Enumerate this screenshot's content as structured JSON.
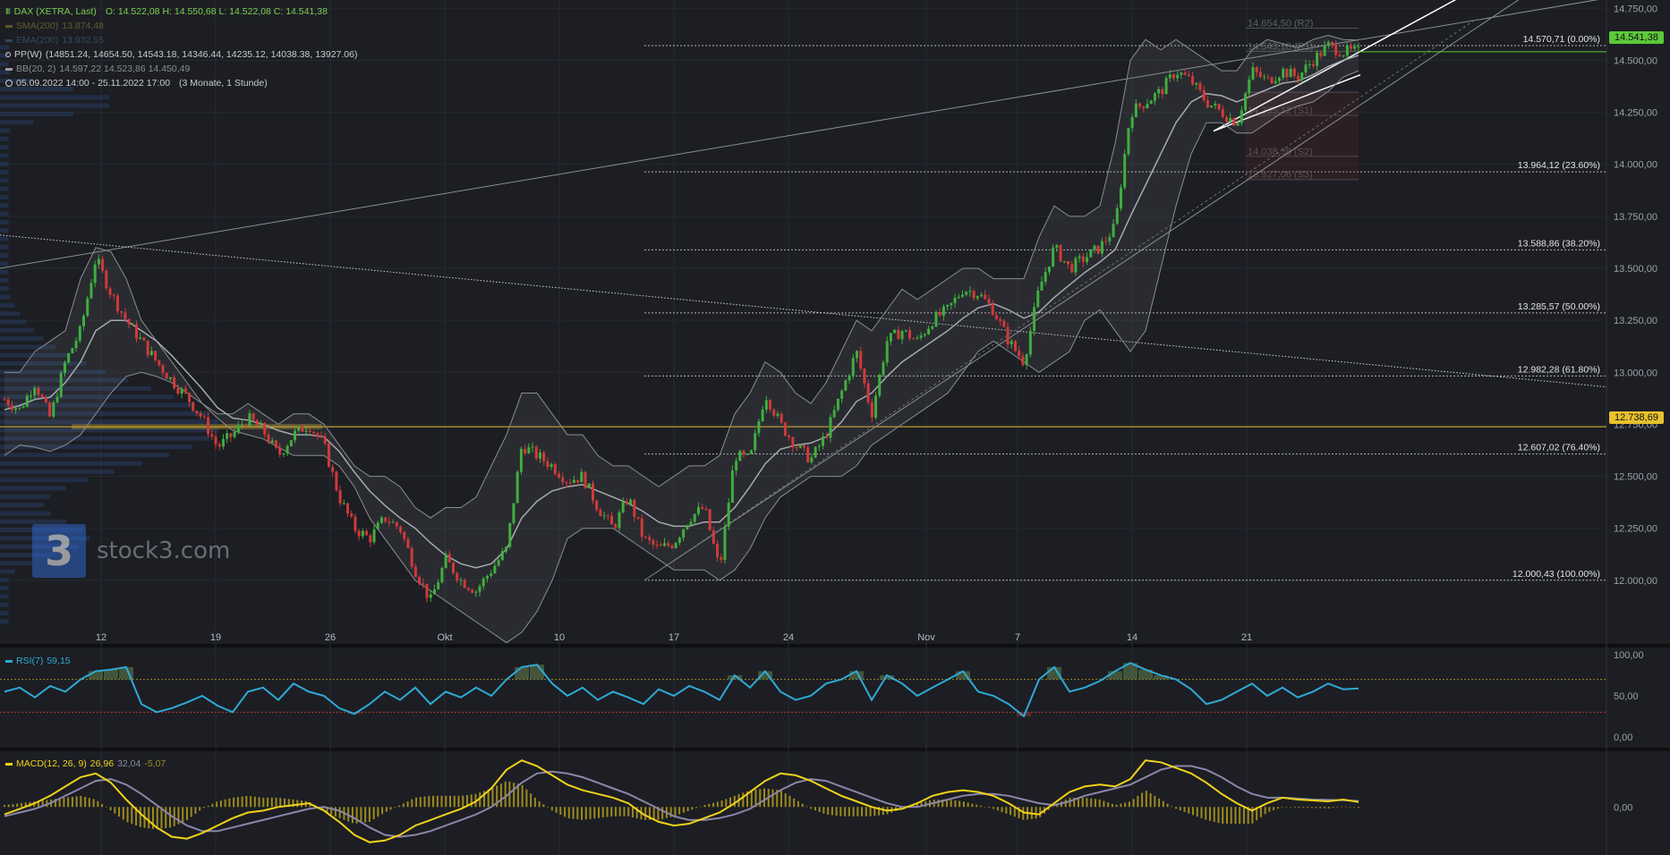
{
  "header": {
    "title": "DAX (XETRA, Last)",
    "ohlc": "O: 14.522,08  H: 14.550,68  L: 14.522,08  C: 14.541,38",
    "sma": "SMA(200)",
    "sma_value": "13.874,48",
    "ema": "EMA(200)",
    "ema_value": "13.932,55",
    "pp": "PP(W)",
    "pp_values": "(14851.24, 14654.50, 14543.18, 14346.44, 14235.12, 14038.38, 13927.06)",
    "bb": "BB(20, 2)",
    "bb_values": "14.597,22  14.523,86  14.450,49",
    "period": "05.09.2022 14:00 - 25.11.2022 17:00",
    "period_note": "(3 Monate, 1 Stunde)"
  },
  "rsi_panel": {
    "label": "RSI(7)",
    "value": "59,15"
  },
  "macd_panel": {
    "label": "MACD(12, 26, 9)",
    "v1": "26,96",
    "v2": "32,04",
    "v3": "-5,07"
  },
  "watermark": {
    "logo_glyph": "3",
    "brand": "stock3.com"
  },
  "colors": {
    "background": "#1c1e23",
    "up": "#3fae3f",
    "down": "#d03a3a",
    "rsi": "#2eaad6",
    "macd": "#f2d21b",
    "signal": "#8b86a8",
    "hist": "#9c8a1e",
    "highlight": "#e8c12d",
    "last_price": "#5dc93a"
  },
  "chart_data": [
    {
      "type": "candlestick",
      "title": "DAX (XETRA, Last)",
      "x_ticks": [
        "12",
        "19",
        "26",
        "Okt",
        "10",
        "17",
        "24",
        "Nov",
        "7",
        "14",
        "21"
      ],
      "y_ticks": [
        "12.000,00",
        "12.250,00",
        "12.500,00",
        "12.750,00",
        "13.000,00",
        "13.250,00",
        "13.500,00",
        "13.750,00",
        "14.000,00",
        "14.250,00",
        "14.500,00",
        "14.750,00"
      ],
      "y_tick_values": [
        12000,
        12250,
        12500,
        12750,
        13000,
        13250,
        13500,
        13750,
        14000,
        14250,
        14500,
        14750
      ],
      "ylim": [
        11750,
        14790
      ],
      "close_path": [
        12870,
        12820,
        12950,
        12780,
        13050,
        13200,
        13550,
        13380,
        13250,
        13150,
        13050,
        12960,
        12880,
        12780,
        12640,
        12700,
        12780,
        12720,
        12600,
        12700,
        12750,
        12650,
        12400,
        12250,
        12200,
        12300,
        12250,
        12050,
        11900,
        12100,
        12000,
        11950,
        12050,
        12150,
        12650,
        12600,
        12550,
        12480,
        12500,
        12350,
        12250,
        12400,
        12200,
        12150,
        12180,
        12300,
        12350,
        12050,
        12600,
        12580,
        12900,
        12750,
        12650,
        12580,
        12700,
        12900,
        13100,
        12800,
        13150,
        13200,
        13150,
        13250,
        13300,
        13400,
        13380,
        13300,
        13150,
        13050,
        13400,
        13600,
        13500,
        13550,
        13600,
        13700,
        14250,
        14300,
        14350,
        14450,
        14400,
        14300,
        14250,
        14200,
        14450,
        14400,
        14450,
        14420,
        14500,
        14570,
        14540,
        14541
      ],
      "bb_upper": [
        13000,
        13000,
        13100,
        13150,
        13200,
        13450,
        13600,
        13580,
        13450,
        13250,
        13150,
        13050,
        12950,
        12850,
        12800,
        12800,
        12850,
        12800,
        12750,
        12800,
        12800,
        12750,
        12650,
        12550,
        12500,
        12500,
        12450,
        12350,
        12300,
        12350,
        12350,
        12400,
        12550,
        12700,
        12900,
        12900,
        12800,
        12700,
        12700,
        12600,
        12550,
        12550,
        12500,
        12450,
        12500,
        12550,
        12550,
        12600,
        12800,
        12900,
        13050,
        13000,
        12900,
        12850,
        12950,
        13100,
        13250,
        13200,
        13300,
        13400,
        13350,
        13400,
        13450,
        13500,
        13500,
        13450,
        13450,
        13450,
        13650,
        13800,
        13750,
        13750,
        13800,
        14100,
        14500,
        14600,
        14550,
        14600,
        14550,
        14500,
        14450,
        14450,
        14550,
        14600,
        14580,
        14560,
        14600,
        14620,
        14600,
        14597
      ],
      "bb_middle": [
        12820,
        12840,
        12870,
        12880,
        12950,
        13050,
        13200,
        13250,
        13250,
        13200,
        13150,
        13080,
        13000,
        12920,
        12830,
        12780,
        12770,
        12750,
        12720,
        12700,
        12700,
        12690,
        12620,
        12520,
        12430,
        12360,
        12300,
        12250,
        12180,
        12120,
        12080,
        12060,
        12080,
        12150,
        12300,
        12380,
        12430,
        12450,
        12460,
        12430,
        12400,
        12370,
        12330,
        12280,
        12260,
        12260,
        12280,
        12280,
        12350,
        12450,
        12560,
        12630,
        12650,
        12660,
        12690,
        12760,
        12860,
        12900,
        12980,
        13050,
        13100,
        13150,
        13200,
        13260,
        13310,
        13330,
        13300,
        13260,
        13290,
        13360,
        13420,
        13480,
        13530,
        13590,
        13750,
        13900,
        14050,
        14200,
        14300,
        14340,
        14330,
        14300,
        14330,
        14360,
        14390,
        14400,
        14430,
        14470,
        14500,
        14524
      ],
      "bb_lower": [
        12600,
        12650,
        12640,
        12620,
        12650,
        12700,
        12800,
        12900,
        12980,
        13000,
        12980,
        12950,
        12900,
        12850,
        12780,
        12720,
        12700,
        12680,
        12640,
        12600,
        12600,
        12600,
        12550,
        12450,
        12300,
        12200,
        12100,
        12000,
        11950,
        11900,
        11850,
        11800,
        11750,
        11700,
        11750,
        11850,
        12000,
        12200,
        12250,
        12250,
        12250,
        12200,
        12150,
        12100,
        12050,
        12050,
        12050,
        12000,
        12050,
        12150,
        12300,
        12400,
        12450,
        12500,
        12500,
        12500,
        12550,
        12650,
        12700,
        12750,
        12800,
        12850,
        12900,
        13000,
        13100,
        13150,
        13100,
        13050,
        13000,
        13050,
        13100,
        13250,
        13300,
        13200,
        13100,
        13200,
        13500,
        13800,
        14050,
        14200,
        14200,
        14150,
        14150,
        14200,
        14250,
        14280,
        14300,
        14350,
        14420,
        14450
      ],
      "fibonacci": [
        {
          "price": 14570.71,
          "label": "14.570,71 (0.00%)"
        },
        {
          "price": 13964.12,
          "label": "13.964,12 (23.60%)"
        },
        {
          "price": 13588.86,
          "label": "13.588,86 (38.20%)"
        },
        {
          "price": 13285.57,
          "label": "13.285,57 (50.00%)"
        },
        {
          "price": 12982.28,
          "label": "12.982,28 (61.80%)"
        },
        {
          "price": 12607.02,
          "label": "12.607,02 (76.40%)"
        },
        {
          "price": 12000.43,
          "label": "12.000,43 (100.00%)"
        }
      ],
      "pivot_levels": [
        {
          "price": 14654.5,
          "label": "14.654,50 (R2)"
        },
        {
          "price": 14543.18,
          "label": "14.543,18 (R1)"
        },
        {
          "price": 14346.44,
          "label": ""
        },
        {
          "price": 14235.12,
          "label": "14.235,12 (S1)"
        },
        {
          "price": 14038.38,
          "label": "14.038,38 (S2)"
        },
        {
          "price": 13927.06,
          "label": "13.927,06 (S3)"
        }
      ],
      "last_price": {
        "value": 14541.38,
        "label": "14.541,38"
      },
      "highlight_price": {
        "value": 12738.69,
        "label": "12.738,69"
      }
    },
    {
      "type": "line",
      "title": "RSI(7)",
      "y_ticks": [
        "100,00",
        "50,00",
        "0,00"
      ],
      "y_tick_values": [
        100,
        50,
        0
      ],
      "ylim": [
        -10,
        110
      ],
      "overbought": 70,
      "oversold": 30,
      "values": [
        55,
        60,
        48,
        62,
        55,
        70,
        80,
        82,
        85,
        40,
        30,
        35,
        42,
        50,
        38,
        30,
        55,
        60,
        45,
        65,
        55,
        50,
        35,
        28,
        40,
        55,
        45,
        60,
        40,
        55,
        48,
        60,
        50,
        70,
        85,
        88,
        65,
        50,
        60,
        45,
        55,
        48,
        40,
        58,
        50,
        62,
        55,
        45,
        75,
        60,
        80,
        55,
        45,
        50,
        65,
        70,
        80,
        45,
        75,
        65,
        50,
        60,
        70,
        80,
        55,
        50,
        40,
        25,
        70,
        85,
        55,
        60,
        68,
        80,
        90,
        82,
        75,
        70,
        58,
        40,
        45,
        55,
        65,
        50,
        60,
        48,
        55,
        65,
        58,
        59
      ]
    },
    {
      "type": "line",
      "title": "MACD(12, 26, 9)",
      "y_ticks": [
        "0,00"
      ],
      "y_tick_values": [
        0
      ],
      "ylim": [
        -210,
        280
      ],
      "series": [
        {
          "name": "MACD",
          "values": [
            -40,
            -10,
            20,
            60,
            110,
            160,
            180,
            130,
            40,
            -40,
            -110,
            -160,
            -170,
            -140,
            -100,
            -60,
            -30,
            -20,
            0,
            10,
            20,
            -20,
            -80,
            -150,
            -190,
            -180,
            -150,
            -100,
            -70,
            -40,
            -10,
            30,
            100,
            200,
            250,
            220,
            170,
            120,
            90,
            70,
            50,
            20,
            -40,
            -80,
            -100,
            -90,
            -60,
            -30,
            20,
            80,
            140,
            180,
            170,
            140,
            100,
            60,
            30,
            0,
            -20,
            -10,
            20,
            60,
            80,
            90,
            80,
            60,
            20,
            -30,
            -40,
            20,
            80,
            110,
            120,
            110,
            150,
            250,
            240,
            210,
            180,
            130,
            70,
            20,
            -20,
            20,
            50,
            40,
            35,
            30,
            40,
            27
          ]
        },
        {
          "name": "Signal",
          "values": [
            -50,
            -30,
            -10,
            20,
            60,
            100,
            140,
            150,
            120,
            70,
            10,
            -50,
            -100,
            -130,
            -130,
            -110,
            -90,
            -70,
            -50,
            -30,
            -10,
            0,
            -20,
            -60,
            -110,
            -150,
            -160,
            -150,
            -130,
            -100,
            -70,
            -40,
            0,
            60,
            130,
            180,
            190,
            180,
            160,
            130,
            100,
            70,
            30,
            -10,
            -50,
            -70,
            -70,
            -60,
            -40,
            -10,
            40,
            90,
            130,
            150,
            140,
            110,
            80,
            50,
            20,
            0,
            0,
            20,
            40,
            60,
            70,
            70,
            60,
            40,
            20,
            10,
            30,
            60,
            80,
            100,
            120,
            160,
            200,
            220,
            220,
            200,
            160,
            110,
            70,
            50,
            50,
            45,
            40,
            38,
            36,
            32
          ]
        }
      ]
    }
  ]
}
